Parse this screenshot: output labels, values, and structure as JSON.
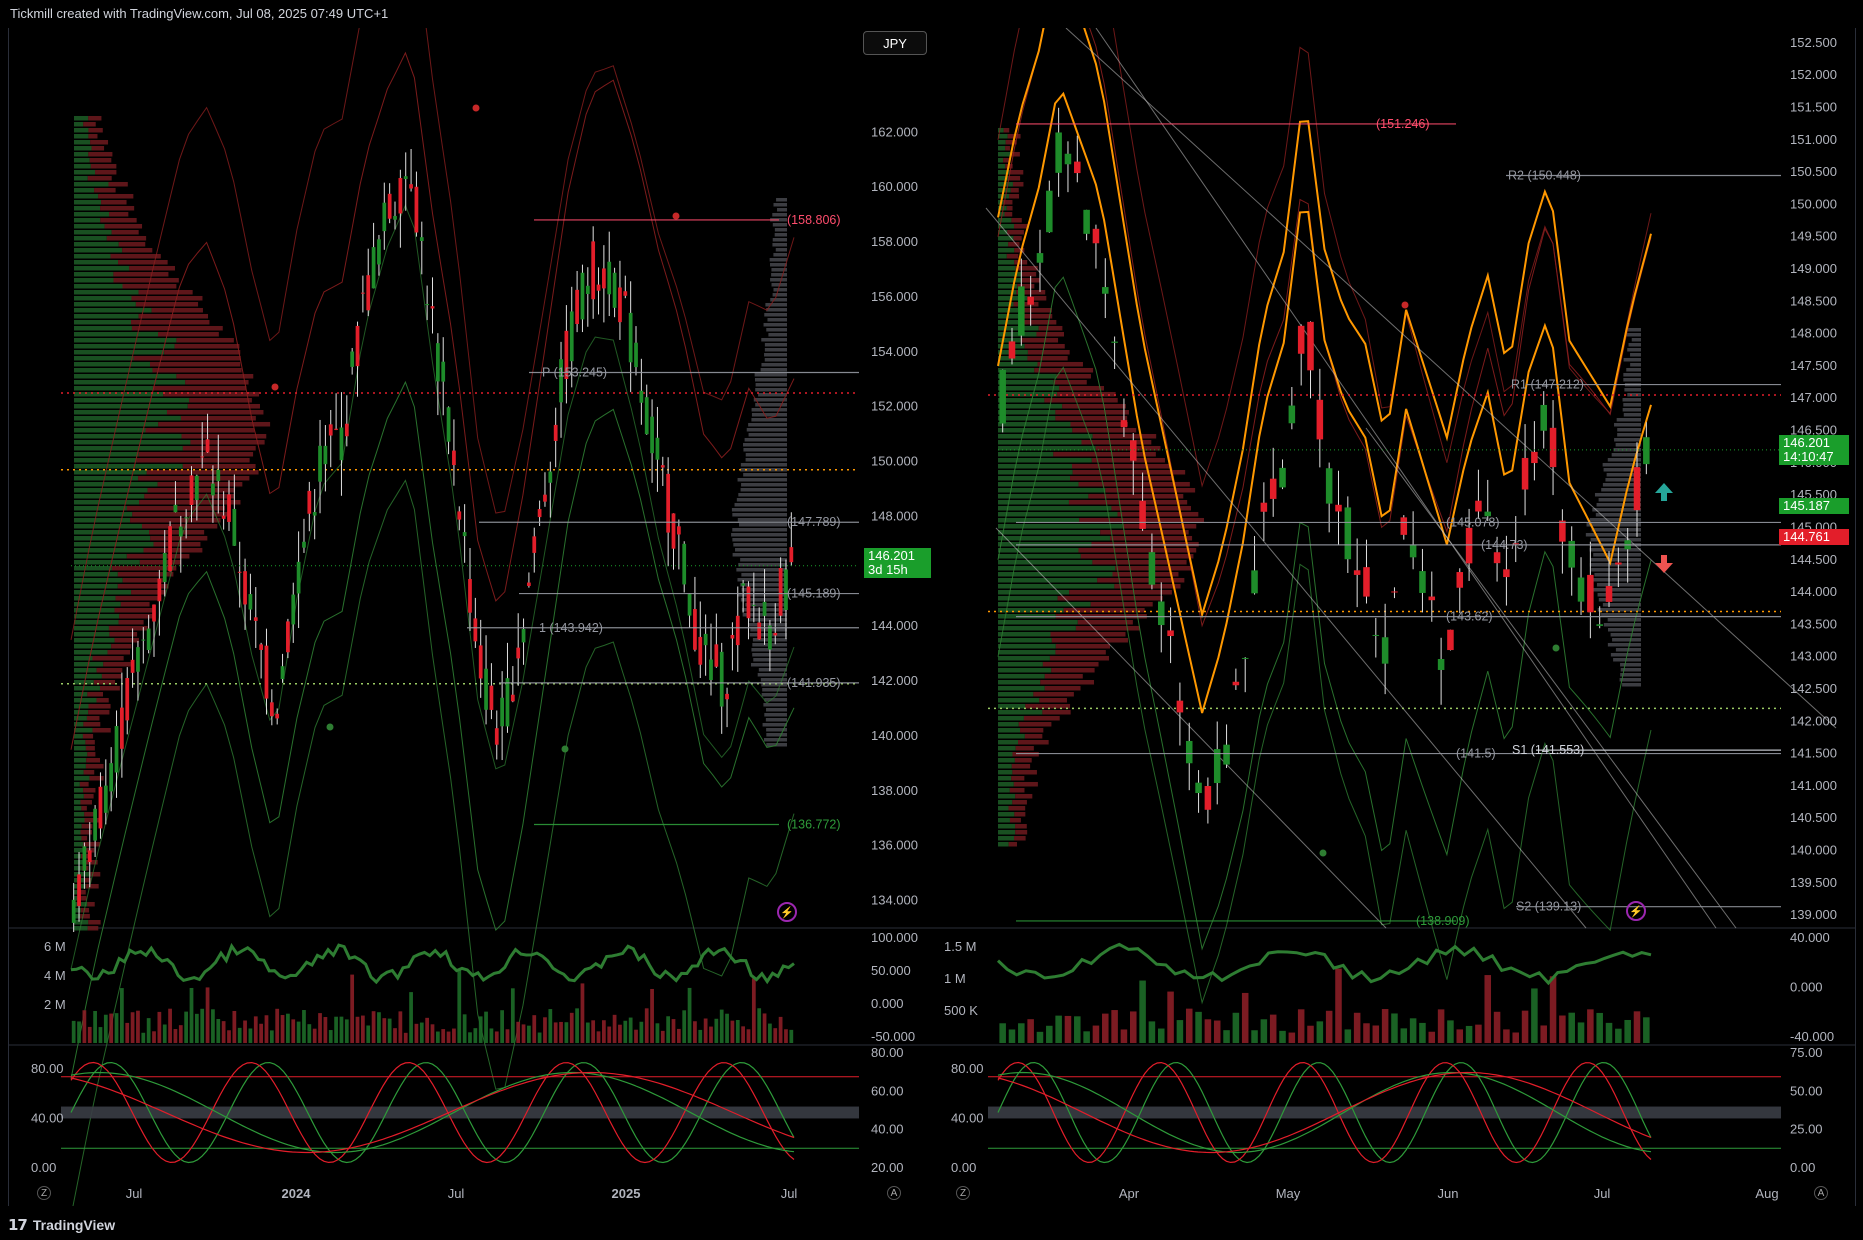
{
  "header": {
    "text": "Tickmill created with TradingView.com, Jul 08, 2025 07:49 UTC+1"
  },
  "footer": {
    "logo": "TradingView"
  },
  "colors": {
    "up": "#1e8c2a",
    "down": "#e31e2a",
    "accent_red": "#ff4d6d",
    "green_line": "#2e9b3a",
    "orange": "#ff9800"
  },
  "left": {
    "currency": "JPY",
    "price_tag": "146.201",
    "price_tag_sub": "3d 15h",
    "levels": [
      {
        "label": "(158.806)",
        "value": 158.806,
        "color": "#ff4d6d"
      },
      {
        "label": "(147.789)",
        "value": 147.789,
        "color": "#9598a1"
      },
      {
        "label": "(145.189)",
        "value": 145.189,
        "color": "#9598a1"
      },
      {
        "label": "1 (143.942)",
        "value": 143.942,
        "color": "#9598a1"
      },
      {
        "label": "(141.935)",
        "value": 141.935,
        "color": "#9598a1"
      },
      {
        "label": "(136.772)",
        "value": 136.772,
        "color": "#2e9b3a"
      },
      {
        "label": "P (153.245)",
        "value": 153.245,
        "color": "#9598a1"
      }
    ],
    "volume_labels": [
      "6 M",
      "4 M",
      "2 M"
    ],
    "vol_osc_ticks": [
      "100.000",
      "50.000",
      "0.000",
      "-50.000"
    ],
    "stoch_left_ticks": [
      "80.00",
      "40.00",
      "0.00"
    ],
    "stoch_right_ticks": [
      "80.00",
      "60.00",
      "40.00",
      "20.00"
    ],
    "x_labels": [
      "Jul",
      "2024",
      "Jul",
      "2025",
      "Jul"
    ]
  },
  "right": {
    "price_tag": "146.201",
    "price_tag_sub": "14:10:47",
    "tag_green": "145.187",
    "tag_red": "144.761",
    "levels": [
      {
        "label": "(151.246)",
        "value": 151.246,
        "color": "#ff4d6d"
      },
      {
        "label": "R2 (150.448)",
        "value": 150.448,
        "color": "#9598a1"
      },
      {
        "label": "R1 (147.212)",
        "value": 147.212,
        "color": "#9598a1"
      },
      {
        "label": "(145.078)",
        "value": 145.078,
        "color": "#9598a1"
      },
      {
        "label": "(144.73)",
        "value": 144.73,
        "color": "#9598a1"
      },
      {
        "label": "(143.62)",
        "value": 143.62,
        "color": "#9598a1"
      },
      {
        "label": "(141.5)",
        "value": 141.5,
        "color": "#9598a1"
      },
      {
        "label": "S1 (141.553)",
        "value": 141.553,
        "color": "#d1d4dc"
      },
      {
        "label": "S2 (139.13)",
        "value": 139.13,
        "color": "#9598a1"
      },
      {
        "label": "(138.909)",
        "value": 138.909,
        "color": "#2e9b3a"
      }
    ],
    "volume_labels": [
      "1.5 M",
      "1 M",
      "500 K"
    ],
    "vol_osc_ticks": [
      "40.000",
      "0.000",
      "-40.000"
    ],
    "stoch_left_ticks": [
      "80.00",
      "40.00",
      "0.00"
    ],
    "stoch_right_ticks": [
      "75.00",
      "50.00",
      "25.00",
      "0.00"
    ],
    "x_labels": [
      "Apr",
      "May",
      "Jun",
      "Jul",
      "Aug"
    ]
  },
  "chart_data": [
    {
      "type": "candlestick",
      "title": "",
      "symbol_currency": "JPY",
      "timeframe_hint": "weekly",
      "y_ticks": [
        134,
        136,
        138,
        140,
        142,
        144,
        146,
        148,
        150,
        152,
        154,
        156,
        158,
        160,
        162
      ],
      "ylim": [
        133,
        165
      ],
      "last_price": 146.201,
      "x_labels": [
        "Jul",
        "2024",
        "Jul",
        "2025",
        "Jul"
      ],
      "close_path": [
        133.5,
        137,
        140,
        143,
        146,
        149,
        150,
        148,
        144,
        141,
        146,
        150,
        151,
        156,
        159,
        161,
        155,
        150,
        143,
        140,
        144,
        149,
        154,
        157,
        157,
        154,
        150,
        147,
        143,
        142,
        145,
        144,
        146.2
      ]
    },
    {
      "type": "candlestick",
      "title": "",
      "timeframe_hint": "daily",
      "y_ticks": [
        139,
        139.5,
        140,
        140.5,
        141,
        141.5,
        142,
        142.5,
        143,
        143.5,
        144,
        144.5,
        145,
        145.5,
        146,
        146.5,
        147,
        147.5,
        148,
        148.5,
        149,
        149.5,
        150,
        150.5,
        151,
        151.5,
        152,
        152.5
      ],
      "ylim": [
        138.8,
        152.7
      ],
      "last_price": 146.201,
      "x_labels": [
        "Apr",
        "May",
        "Jun",
        "Jul",
        "Aug"
      ],
      "close_path": [
        147,
        148.5,
        149.5,
        151,
        150,
        149,
        147,
        145,
        143.5,
        142,
        140.5,
        141.5,
        143,
        145,
        146,
        148.5,
        146,
        145,
        144.5,
        143,
        145,
        144,
        143,
        144.5,
        145.5,
        144,
        146,
        147,
        144.5,
        144,
        143.5,
        145,
        146.2
      ]
    }
  ]
}
